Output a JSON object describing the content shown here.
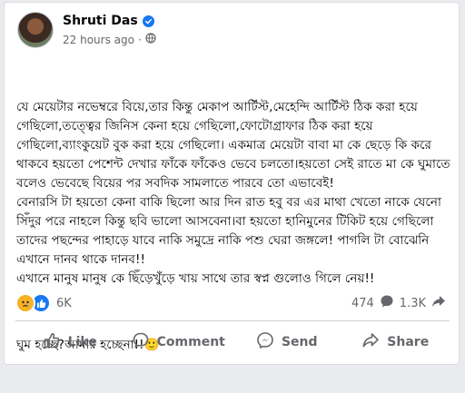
{
  "author": {
    "name": "Shruti Das",
    "timestamp": "22 hours ago",
    "separator": "·"
  },
  "post": {
    "paragraphs": [
      "যে মেয়েটার নভেম্বরে বিয়ে,তার কিন্তু মেকাপ আর্টিস্ট,মেহেন্দি আর্টিস্ট ঠিক করা হয়ে গেছিলো,তত্ত্বের জিনিস কেনা হয়ে গেছিলো,ফোটোগ্রাফার ঠিক করা হয়ে গেছিলো,ব্যাংকুয়েট বুক করা হয়ে গেছিলো। একমাত্র মেয়েটা বাবা মা কে ছেড়ে কি করে থাকবে হয়তো পেশেন্ট দেখার ফাঁকে ফাঁকেও ভেবে চলতো।হয়তো সেই রাতে মা কে ঘুমাতে বলেও ভেবেছে বিয়ের পর সবদিক সামলাতে পারবে তো এভাবেই!\nবেনারসি টা হয়তো কেনা বাকি ছিলো আর দিন রাত হবু বর এর মাথা খেতো নাকে যেনো সিঁদুর পরে নাহলে কিন্তু ছবি ভালো আসবেনা।বা হয়তো হানিমুনের টিকিট হয়ে গেছিলো তাদের পছন্দের পাহাড়ে যাবে নাকি সমুদ্রে নাকি পশু ঘেরা জঙ্গলে! পাগলি টা বোঝেনি এখানে দানব থাকে দানব!!\nএখানে মানুষ মানুষ কে ছিঁড়েখুঁড়ে খায় সাথে তার স্বপ্ন গুলোও গিলে নেয়!!",
      "ঘুম হচ্ছে?আমার হচ্ছেনা!!🙂"
    ]
  },
  "stats": {
    "reactions_count": "6K",
    "comments_count": "474",
    "shares_count": "1.3K"
  },
  "actions": {
    "like": "Like",
    "comment": "Comment",
    "send": "Send",
    "share": "Share"
  },
  "colors": {
    "accent": "#1877f2",
    "sad_reaction": "#f7b125",
    "muted_text": "#65676b"
  }
}
